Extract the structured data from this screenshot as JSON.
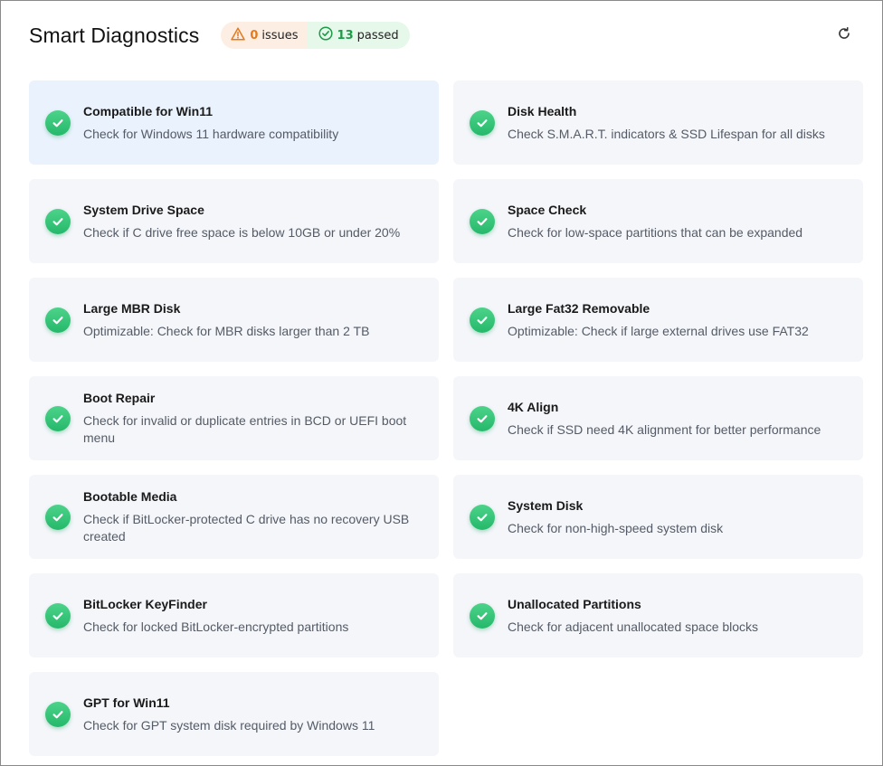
{
  "header": {
    "title": "Smart Diagnostics",
    "issues": {
      "count": "0",
      "label": "issues",
      "icon": "warning-triangle-icon",
      "color": "#e57a1c"
    },
    "passed": {
      "count": "13",
      "label": "passed",
      "icon": "check-circle-icon",
      "color": "#1f9a4a"
    },
    "refresh_icon": "refresh-icon"
  },
  "checks": [
    {
      "title": "Compatible for Win11",
      "desc": "Check for Windows 11 hardware compatibility",
      "selected": true
    },
    {
      "title": "Disk Health",
      "desc": "Check S.M.A.R.T. indicators & SSD Lifespan for all disks"
    },
    {
      "title": "System Drive Space",
      "desc": "Check if C drive free space is below 10GB or under 20%"
    },
    {
      "title": "Space Check",
      "desc": "Check for low-space partitions that can be expanded"
    },
    {
      "title": "Large MBR Disk",
      "desc": "Optimizable: Check for MBR disks larger than 2 TB"
    },
    {
      "title": "Large Fat32 Removable",
      "desc": "Optimizable: Check if large external drives use FAT32"
    },
    {
      "title": "Boot Repair",
      "desc": "Check for invalid or duplicate entries in BCD or UEFI boot menu"
    },
    {
      "title": "4K Align",
      "desc": "Check if SSD need 4K alignment for better performance"
    },
    {
      "title": "Bootable Media",
      "desc": "Check if BitLocker-protected C drive has no recovery USB created"
    },
    {
      "title": "System Disk",
      "desc": "Check for non-high-speed system disk"
    },
    {
      "title": "BitLocker KeyFinder",
      "desc": "Check for locked BitLocker-encrypted partitions"
    },
    {
      "title": "Unallocated Partitions",
      "desc": "Check for adjacent unallocated space blocks"
    },
    {
      "title": "GPT for Win11",
      "desc": "Check for GPT system disk required by Windows 11"
    }
  ],
  "colors": {
    "accent_ok": "#25b86a",
    "card_bg": "#f4f6fa",
    "card_selected_bg": "#eaf2fd"
  }
}
